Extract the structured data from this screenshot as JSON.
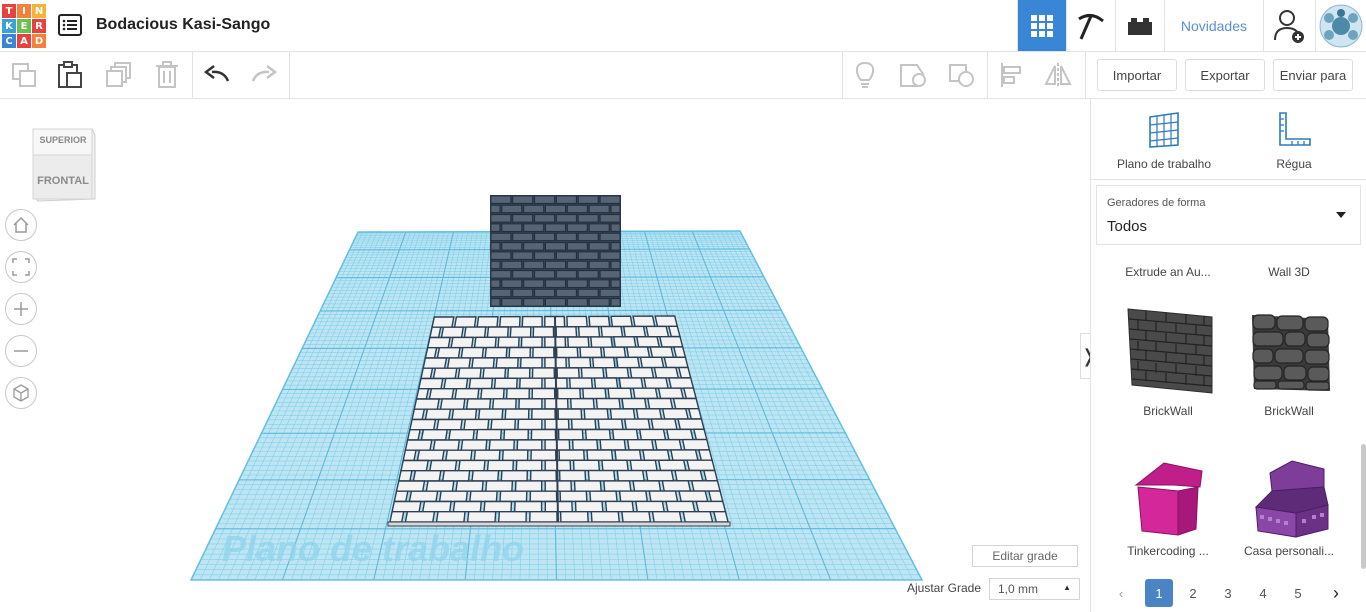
{
  "header": {
    "logo_letters": [
      "T",
      "I",
      "N",
      "K",
      "E",
      "R",
      "C",
      "A",
      "D"
    ],
    "logo_colors": [
      "#e8423f",
      "#f4813b",
      "#f6b33a",
      "#3aa2d8",
      "#6bbf4c",
      "#e8423f",
      "#3a86d6",
      "#e8423f",
      "#f4813b"
    ],
    "title": "Bodacious Kasi-Sango",
    "novidades": "Novidades",
    "active_color": "#3a86d6"
  },
  "toolbar": {
    "importar": "Importar",
    "exportar": "Exportar",
    "enviar_para": "Enviar para"
  },
  "viewport": {
    "viewcube_top": "SUPERIOR",
    "viewcube_front": "FRONTAL",
    "workplane_label": "Plano de trabalho",
    "edit_grid": "Editar grade",
    "snap_label": "Ajustar Grade",
    "snap_value": "1,0 mm",
    "grid_color": "#7fd0ea"
  },
  "panel": {
    "workplane_tool": "Plano de trabalho",
    "ruler_tool": "Régua",
    "dropdown_label": "Geradores de forma",
    "dropdown_value": "Todos",
    "row0": [
      "Extrude an Au...",
      "Wall 3D"
    ],
    "shapes": [
      {
        "name": "BrickWall",
        "icon": "brick-wall-icon"
      },
      {
        "name": "BrickWall",
        "icon": "stone-wall-icon"
      },
      {
        "name": "Tinkercoding ...",
        "icon": "pink-house-icon"
      },
      {
        "name": "Casa personali...",
        "icon": "purple-house-icon"
      }
    ],
    "pages": [
      "1",
      "2",
      "3",
      "4",
      "5"
    ],
    "active_page": "1"
  }
}
